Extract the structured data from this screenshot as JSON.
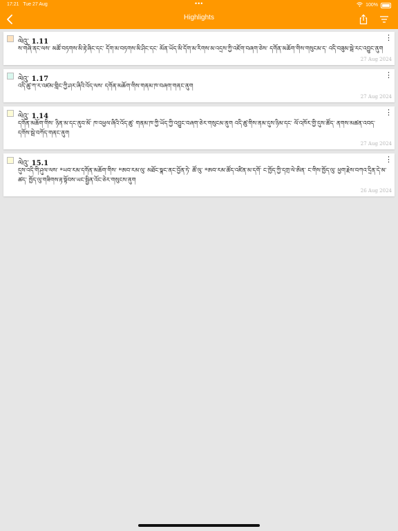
{
  "status": {
    "time": "17:21",
    "date": "Tue 27 Aug",
    "battery": "100%"
  },
  "nav": {
    "title": "Highlights",
    "back_icon": "chevron-left-icon",
    "share_icon": "share-icon",
    "sort_icon": "sort-icon"
  },
  "highlights": [
    {
      "chapter_label": "ལེའུ་",
      "verse": "1.11",
      "swatch_color": "#fde2bf",
      "text": "ས་གཞི་ནང་ལས་ མཚོ་བཏགས་མི་རྟེ་ཞིང་དང་ དོག་མ་བཏགས་མི་ཤིང་དང་ མོན་ཡོད་མི་དོག་མ་རིགས་མ་འདྲས་ཀྱི་འཇོག་བཞག་ཅེས་ དགོན་མཆོག་གིས་གསུངམ་ད་ འདི་བཟུམ་སྦེ་རང་འབྱུང་ནུག",
      "date": "27 Aug 2024"
    },
    {
      "chapter_label": "ལེའུ་",
      "verse": "1.17",
      "swatch_color": "#d9f7ee",
      "text": "འདི་ཚུ་ཀ་ར་འཛམ་གླིང་ཀྱི་ཤར་ཞིའི་འོད་ལས་ དགོན་མཆོག་གིས་གནམ་ཁ་བཞག་གནང་ནུག",
      "date": "27 Aug 2024"
    },
    {
      "chapter_label": "ལེའུ་",
      "verse": "1.14",
      "swatch_color": "#fdfbd6",
      "text": "དགོན་མཆོག་གིས་ ཉིན་མ་དང་ནུབ་མོ་ ཁ་འཕྱལ་ཞིའི་འོད་ཚུ་ གནམ་ཁ་ཀྱི་ཡོད་ཀྱི་འབྱུང་བཞག་ཅེར་གསུངམ་ནུག འདི་ཚུ་གིས་ནམ་དུས་ཉིམ་དང་ ལོ་འཁོར་གྱི་དུས་ཚོད་ ནགས་མཚན་འབད་དགོས་སྦེ་བཀོད་གནང་ནུག",
      "date": "27 Aug 2024"
    },
    {
      "chapter_label": "ལེའུ་",
      "verse": "15.1",
      "swatch_color": "#fdfbd6",
      "text": "དུས་འདི་གི་ཤུལ་ལས་ *ཡབ་རམ་དགོན་མཆོག་གིས་ *ཨབ་རམ་ལུ་ མཐོང་སྣང་ནང་བྱོན་ཏེ་ ཚོ་ལུ་ *ཨབ་རམ་ཚོད་འཛིན་མ་དགོ་ ང་ཁྱོད་ཀྱི་དགྲ་ལེ་ཨིན་ ང་གིས་ཁྱོད་ལུ་ ཕྱག་རྗེས་བཀའ་དྲིན་དེ་མ་ཚད་ ཁྱོད་ལུ་གཟིགས་རྟ་སྟོབས་ཡང་སྦྱིན་འོང་ཅེར་གསུངས་ནུག",
      "date": "26 Aug 2024"
    }
  ]
}
